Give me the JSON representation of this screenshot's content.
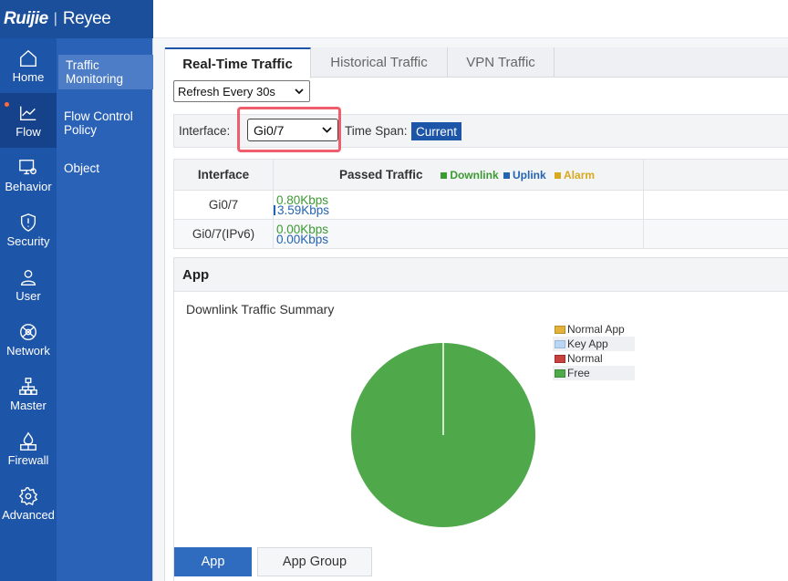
{
  "logo": {
    "brand": "Ruijie",
    "separator": "|",
    "brand2": "Reyee"
  },
  "rail": [
    {
      "label": "Home",
      "icon": "home-icon"
    },
    {
      "label": "Flow",
      "icon": "chart-line-icon",
      "active": true
    },
    {
      "label": "Behavior",
      "icon": "monitor-eye-icon"
    },
    {
      "label": "Security",
      "icon": "shield-alert-icon"
    },
    {
      "label": "User",
      "icon": "user-icon"
    },
    {
      "label": "Network",
      "icon": "globe-icon"
    },
    {
      "label": "Master",
      "icon": "topology-icon"
    },
    {
      "label": "Firewall",
      "icon": "firewall-icon"
    },
    {
      "label": "Advanced",
      "icon": "gear-icon"
    }
  ],
  "submenu": [
    {
      "label": "Traffic Monitoring",
      "active": true
    },
    {
      "label": "Flow Control Policy"
    },
    {
      "label": "Object"
    }
  ],
  "tabs": [
    "Real-Time Traffic",
    "Historical Traffic",
    "VPN Traffic"
  ],
  "refresh": {
    "value": "Refresh Every 30s"
  },
  "filter": {
    "interface_label": "Interface:",
    "interface_value": "Gi0/7",
    "timespan_label": "Time Span:",
    "current_label": "Current"
  },
  "table": {
    "headers": {
      "interface": "Interface",
      "traffic": "Passed Traffic"
    },
    "legend": {
      "downlink": "Downlink",
      "uplink": "Uplink",
      "alarm": "Alarm"
    },
    "rows": [
      {
        "interface": "Gi0/7",
        "down": "0.80Kbps",
        "up": "3.59Kbps"
      },
      {
        "interface": "Gi0/7(IPv6)",
        "down": "0.00Kbps",
        "up": "0.00Kbps"
      }
    ]
  },
  "app": {
    "title": "App",
    "chart_title": "Downlink Traffic Summary",
    "bottom_tabs": [
      "App",
      "App Group"
    ]
  },
  "colors": {
    "rail": "#1d55a8",
    "accent": "#2f6cc0",
    "highlight": "#ee5e6c",
    "normal_app": "#e2b23a",
    "key_app": "#b9d6f2",
    "normal": "#c9413f",
    "free": "#4fa94b"
  },
  "chart_data": {
    "type": "pie",
    "title": "Downlink Traffic Summary",
    "legend_position": "right",
    "categories": [
      "Normal App",
      "Key App",
      "Normal",
      "Free"
    ],
    "values": [
      0,
      0,
      0,
      100
    ]
  }
}
